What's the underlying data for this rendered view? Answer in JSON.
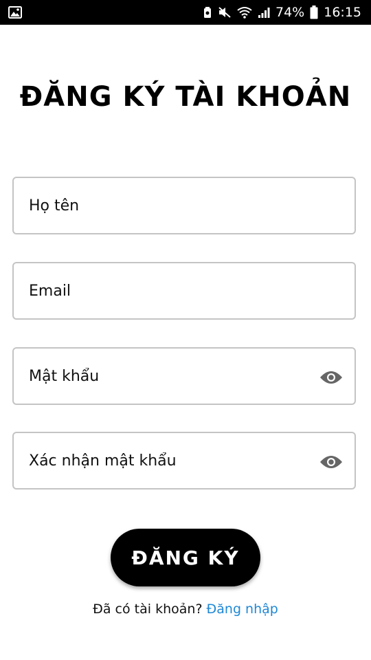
{
  "status_bar": {
    "battery_percent": "74%",
    "time": "16:15",
    "icons": [
      "image-icon",
      "recycle-icon",
      "mute-icon",
      "wifi-icon",
      "signal-icon",
      "battery-icon"
    ]
  },
  "page": {
    "title": "ĐĂNG KÝ TÀI KHOẢN"
  },
  "form": {
    "name_placeholder": "Họ tên",
    "email_placeholder": "Email",
    "password_placeholder": "Mật khẩu",
    "confirm_placeholder": "Xác nhận mật khẩu",
    "submit_label": "ĐĂNG KÝ"
  },
  "footer": {
    "prompt": "Đã có tài khoản?",
    "login_label": "Đăng nhập"
  },
  "colors": {
    "accent": "#000000",
    "link": "#1e88d6",
    "field_border": "#c4c4c4",
    "eye_icon": "#666666"
  }
}
